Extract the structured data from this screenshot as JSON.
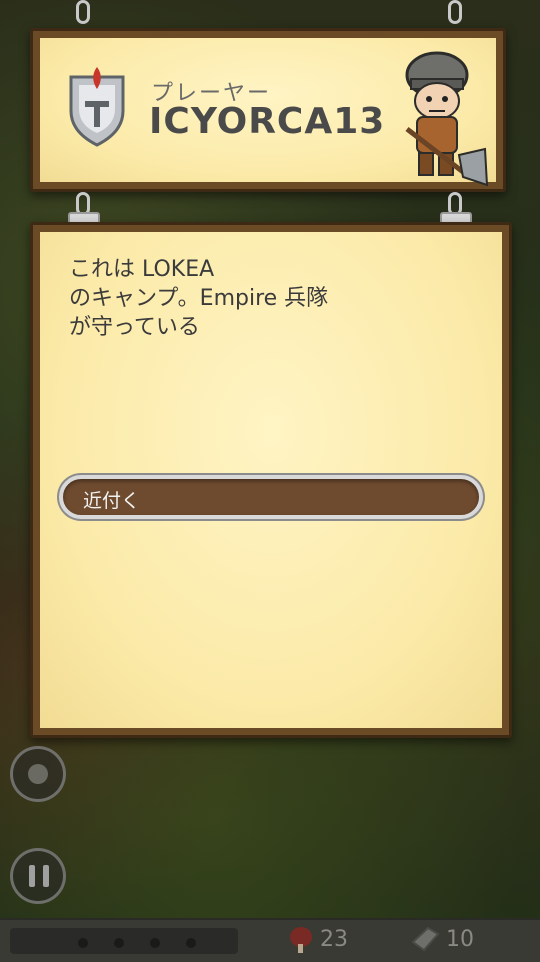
{
  "header": {
    "player_label": "プレーヤー",
    "player_name": "ICYORCA13"
  },
  "card": {
    "message": "これは LOKEA\nのキャンプ。Empire 兵隊\nが守っている",
    "approach_label": "近付く"
  },
  "bottom": {
    "food_count": "23",
    "stone_count": "10"
  },
  "colors": {
    "paper": "#fbeaa8",
    "board": "#6b4a26",
    "button": "#6e4b2f",
    "shield_plume": "#c8352a"
  },
  "icons": [
    "knight-helmet-shield-icon",
    "warrior-avatar",
    "pause-icon",
    "portrait-icon",
    "meat-icon",
    "stone-icon"
  ]
}
